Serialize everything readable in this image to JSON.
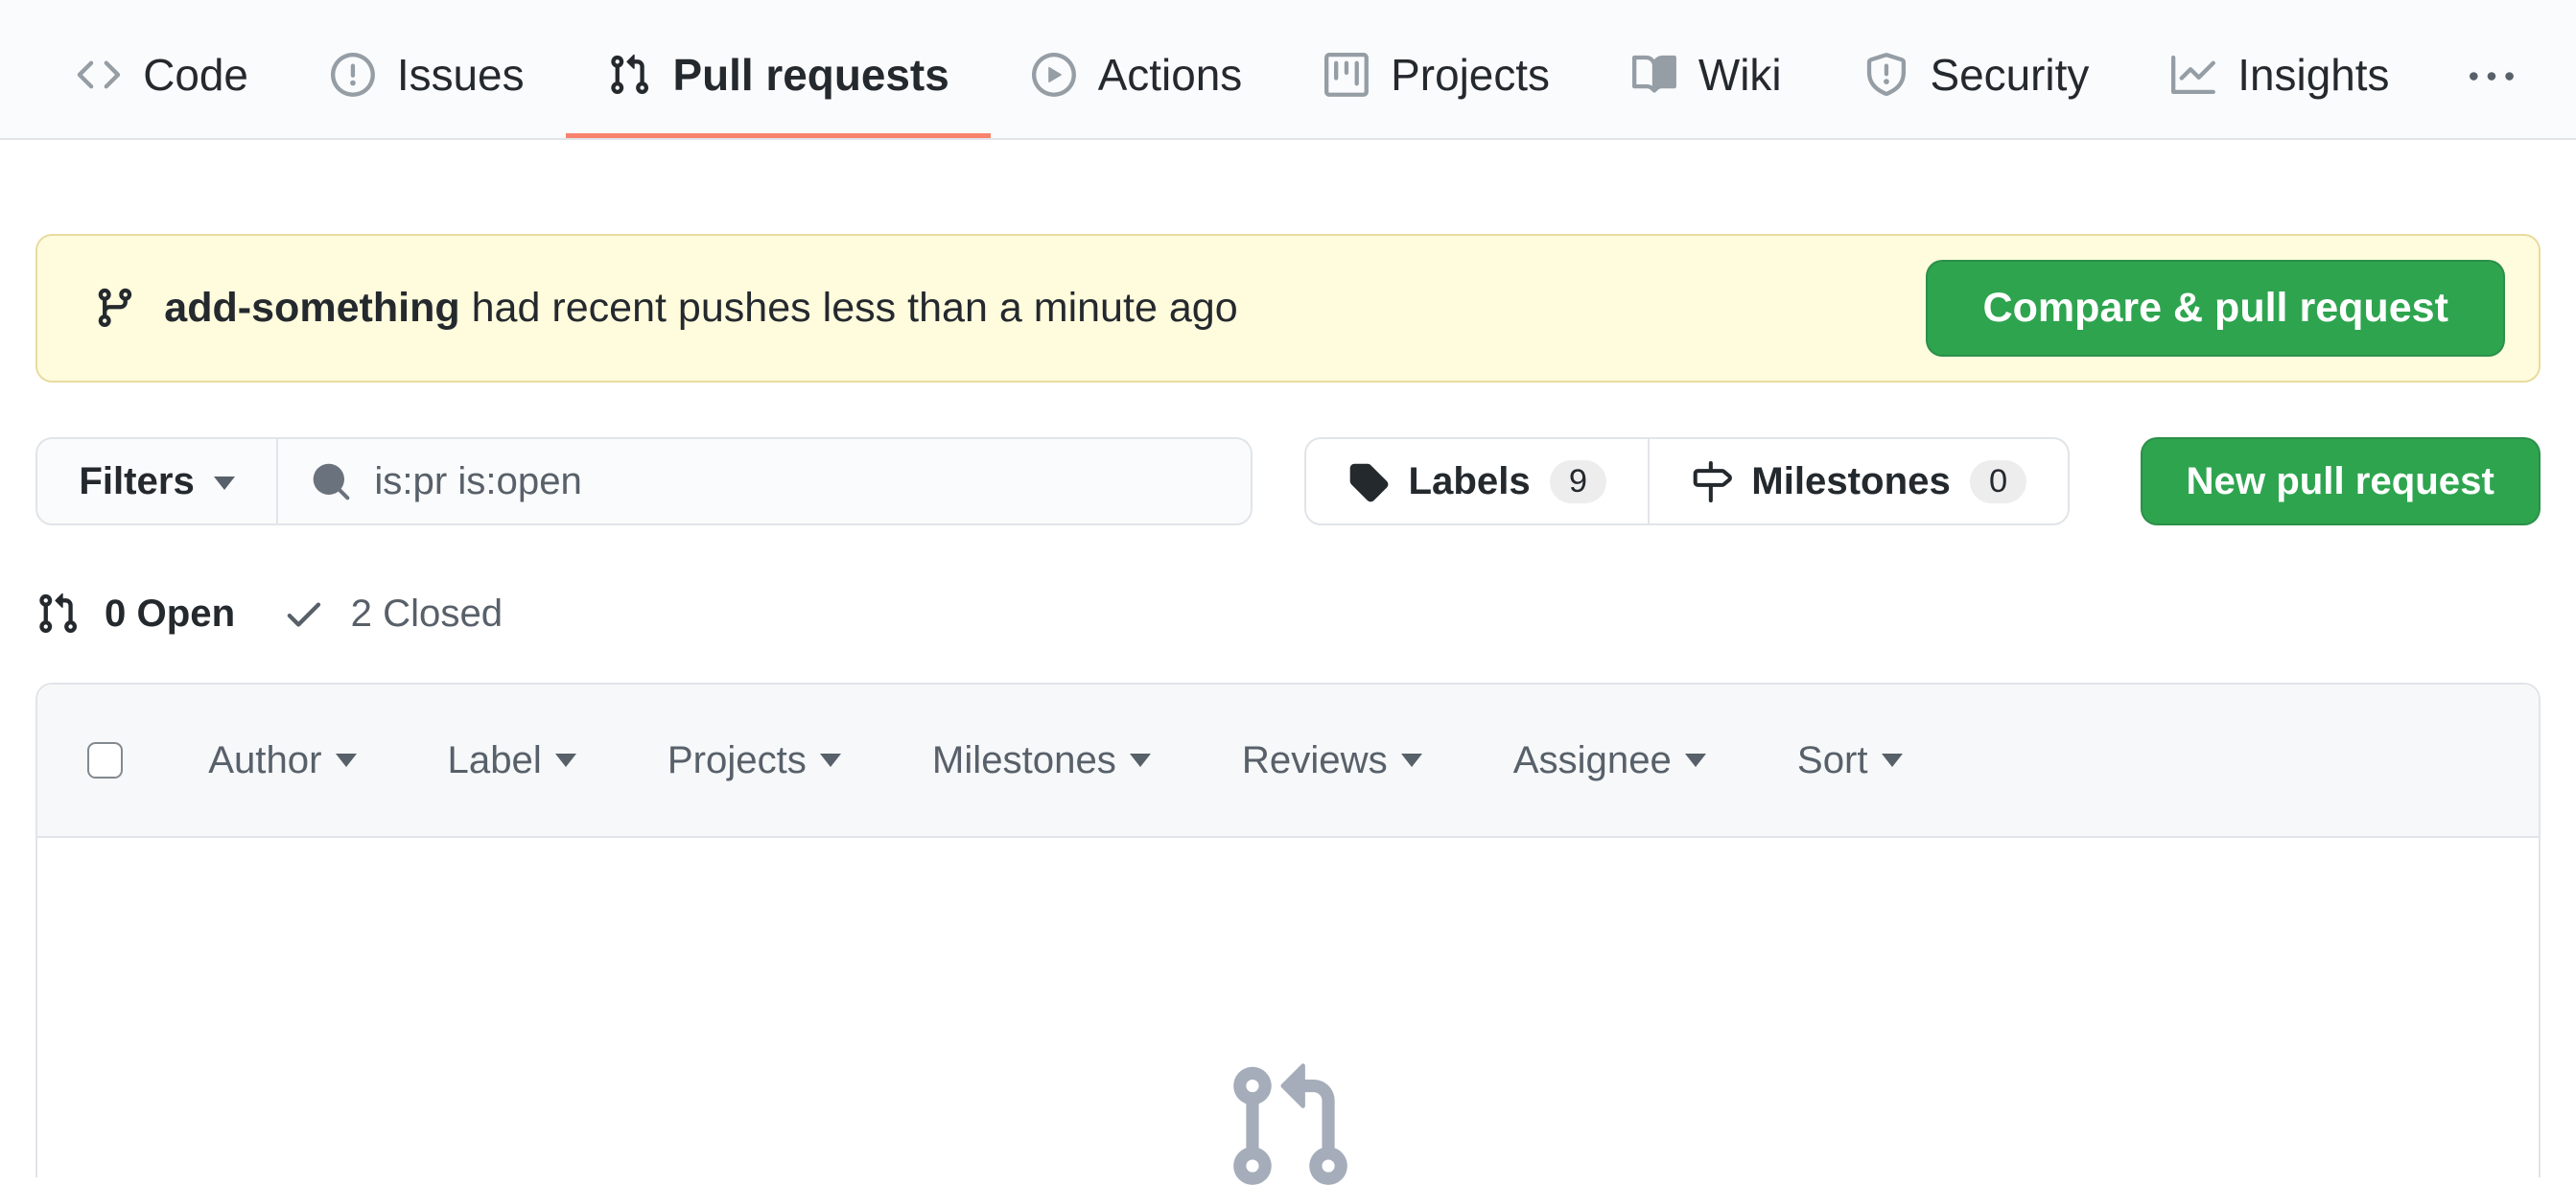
{
  "nav": {
    "tabs": [
      {
        "label": "Code",
        "icon": "code-icon",
        "active": false
      },
      {
        "label": "Issues",
        "icon": "issue-opened-icon",
        "active": false
      },
      {
        "label": "Pull requests",
        "icon": "git-pull-request-icon",
        "active": true
      },
      {
        "label": "Actions",
        "icon": "play-icon",
        "active": false
      },
      {
        "label": "Projects",
        "icon": "project-icon",
        "active": false
      },
      {
        "label": "Wiki",
        "icon": "book-icon",
        "active": false
      },
      {
        "label": "Security",
        "icon": "shield-icon",
        "active": false
      },
      {
        "label": "Insights",
        "icon": "graph-icon",
        "active": false
      }
    ],
    "overflow_icon": "kebab-horizontal-icon",
    "active_underline_color": "#f9826c"
  },
  "banner": {
    "icon": "git-branch-icon",
    "branch_name": "add-something",
    "message": " had recent pushes less than a minute ago",
    "button_label": "Compare & pull request",
    "background_color": "#fffbdd",
    "button_color": "#2ea44f"
  },
  "toolbar": {
    "filters_button_label": "Filters",
    "search": {
      "icon": "search-icon",
      "value": "is:pr is:open"
    },
    "labels_button": {
      "icon": "tag-icon",
      "label": "Labels",
      "count": "9"
    },
    "milestones_button": {
      "icon": "milestone-icon",
      "label": "Milestones",
      "count": "0"
    },
    "new_pr_button_label": "New pull request"
  },
  "states": {
    "open": {
      "icon": "git-pull-request-icon",
      "label": "0 Open"
    },
    "closed": {
      "icon": "check-icon",
      "label": "2 Closed"
    }
  },
  "table_header": {
    "columns": [
      {
        "label": "Author"
      },
      {
        "label": "Label"
      },
      {
        "label": "Projects"
      },
      {
        "label": "Milestones"
      },
      {
        "label": "Reviews"
      },
      {
        "label": "Assignee"
      },
      {
        "label": "Sort"
      }
    ]
  },
  "empty_state": {
    "icon": "git-pull-request-icon"
  },
  "colors": {
    "nav_background": "#fafbfc",
    "border": "#e1e4e8",
    "text_primary": "#24292e",
    "text_secondary": "#586069",
    "green_button": "#2ea44f",
    "table_header_background": "#f6f8fa"
  }
}
